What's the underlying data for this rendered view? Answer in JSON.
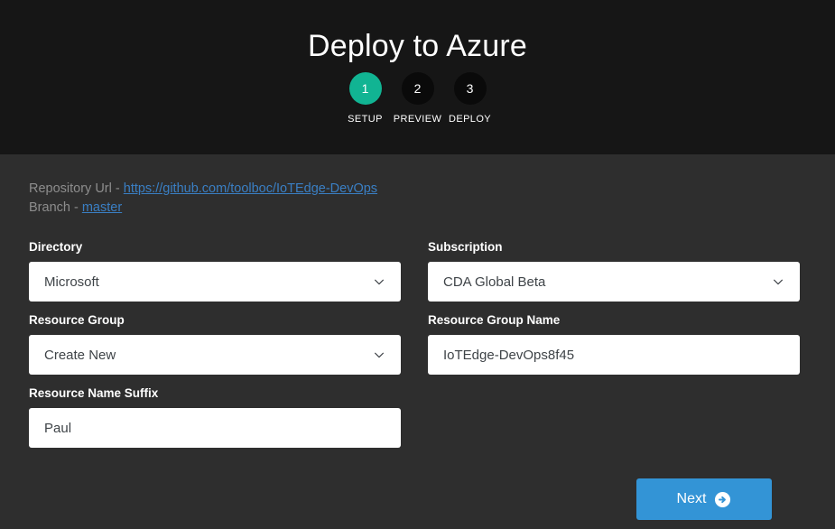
{
  "header": {
    "title": "Deploy to Azure",
    "steps": [
      {
        "number": "1",
        "label": "SETUP",
        "active": true
      },
      {
        "number": "2",
        "label": "PREVIEW",
        "active": false
      },
      {
        "number": "3",
        "label": "DEPLOY",
        "active": false
      }
    ]
  },
  "repository": {
    "url_prefix": "Repository Url - ",
    "url_value": "https://github.com/toolboc/IoTEdge-DevOps",
    "branch_prefix": "Branch - ",
    "branch_value": "master"
  },
  "form": {
    "directory": {
      "label": "Directory",
      "value": "Microsoft",
      "type": "select",
      "icon": "chevron-down-icon"
    },
    "subscription": {
      "label": "Subscription",
      "value": "CDA Global Beta",
      "type": "select",
      "icon": "chevron-down-icon"
    },
    "resource_group": {
      "label": "Resource Group",
      "value": "Create New",
      "type": "select",
      "icon": "chevron-down-icon"
    },
    "resource_group_name": {
      "label": "Resource Group Name",
      "value": "IoTEdge-DevOps8f45",
      "type": "text"
    },
    "resource_name_suffix": {
      "label": "Resource Name Suffix",
      "value": "Paul",
      "type": "text"
    }
  },
  "actions": {
    "next_label": "Next",
    "next_icon": "arrow-right-circle-icon"
  },
  "colors": {
    "header_background": "#161616",
    "body_background": "#2e2e2e",
    "step_active": "#11b493",
    "step_inactive": "#0a0a0a",
    "link": "#3a7fc4",
    "muted_text": "#8d8d8d",
    "primary_button": "#3394d6",
    "input_background": "#ffffff",
    "input_text": "#3f4448"
  }
}
